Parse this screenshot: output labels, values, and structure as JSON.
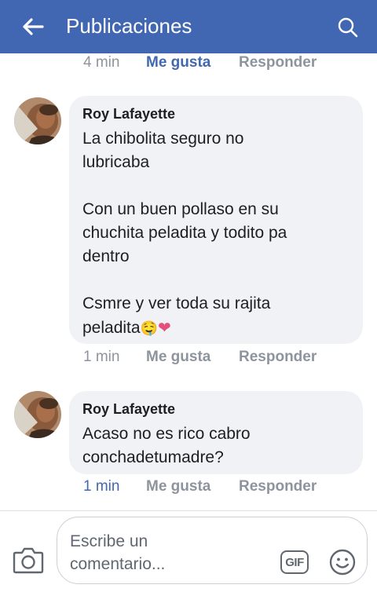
{
  "header": {
    "title": "Publicaciones",
    "back_icon": "arrow-left-icon",
    "search_icon": "search-icon",
    "bg_color": "#4267b2"
  },
  "top_meta": {
    "time": "4 min",
    "like": "Me gusta",
    "reply": "Responder"
  },
  "comments": [
    {
      "author": "Roy Lafayette",
      "text": "La chibolita seguro no\nlubricaba\n\nCon un buen pollaso en su\nchuchita peladita y todito pa\ndentro\n\nCsmre y ver toda su rajita\npeladita",
      "emoji_1": "🤤",
      "emoji_2": "❤",
      "time": "1 min",
      "like": "Me gusta",
      "reply": "Responder"
    },
    {
      "author": "Roy Lafayette",
      "text": "Acaso no es rico cabro\nconchadetumadre?",
      "time": "1 min",
      "like": "Me gusta",
      "reply": "Responder"
    }
  ],
  "composer": {
    "placeholder": "Escribe un comentario...",
    "gif_label": "GIF",
    "camera_icon": "camera-icon",
    "emoji_icon": "smiley-icon"
  }
}
